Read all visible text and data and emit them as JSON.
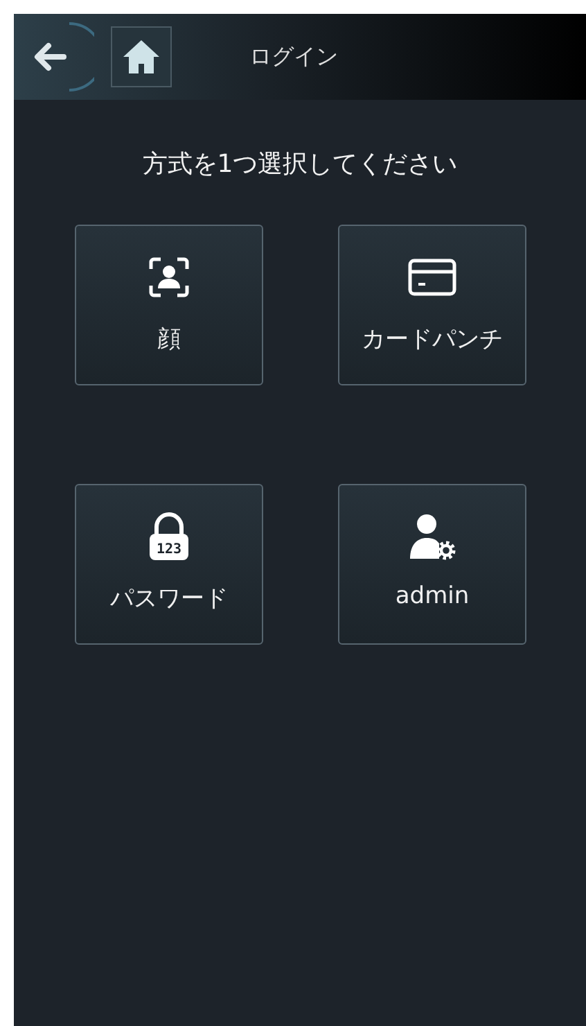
{
  "header": {
    "title": "ログイン"
  },
  "prompt": "方式を1つ選択してください",
  "methods": [
    {
      "kind": "face",
      "label": "顔"
    },
    {
      "kind": "card",
      "label": "カードパンチ"
    },
    {
      "kind": "password",
      "label": "パスワード",
      "icon_text": "123"
    },
    {
      "kind": "admin",
      "label": "admin"
    }
  ]
}
